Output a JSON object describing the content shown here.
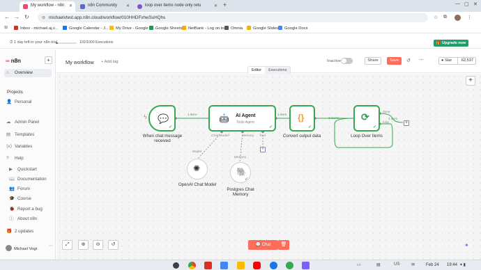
{
  "browser": {
    "tabs": [
      {
        "title": "My workflow - n8n",
        "active": true,
        "color": "#ea4b71"
      },
      {
        "title": "n8n Community",
        "active": false,
        "color": "#5c6bc0"
      },
      {
        "title": "loop over items node only retu",
        "active": false,
        "color": "#7e57c2"
      }
    ],
    "url": "michaelvtest.app.n8n.cloud/workflow/010HHDFxhwSuHQhs",
    "bookmarks": [
      {
        "label": "Inbox - michael.aj.v...",
        "color": "#d93025"
      },
      {
        "label": "Google Calendar - J...",
        "color": "#1a73e8"
      },
      {
        "label": "My Drive - Google D...",
        "color": "#fbbc04"
      },
      {
        "label": "Google Sheets",
        "color": "#0f9d58"
      },
      {
        "label": "NetBank - Log on to...",
        "color": "#f9ab00"
      },
      {
        "label": "Omnia",
        "color": "#555555"
      },
      {
        "label": "Google Slides",
        "color": "#f4b400"
      },
      {
        "label": "Google Docs",
        "color": "#4285f4"
      }
    ]
  },
  "banner": {
    "trial_text": "1 day left in your n8n trial",
    "executions": "102/1000 Executions",
    "progress": 0.102,
    "upgrade_label": "Upgrade now"
  },
  "sidebar": {
    "logo": "n8n",
    "overview": "Overview",
    "projects_heading": "Projects",
    "personal": "Personal",
    "bottom_items": [
      "Admin Panel",
      "Templates",
      "Variables",
      "Help"
    ],
    "help_items": [
      "Quickstart",
      "Documentation",
      "Forum",
      "Course",
      "Report a bug",
      "About n8n"
    ],
    "updates": "2 updates",
    "user_name": "Michael Vogt"
  },
  "topbar": {
    "workflow_name": "My workflow",
    "add_tag": "+ Add tag",
    "inactive_label": "Inactive",
    "share_label": "Share",
    "save_label": "Save",
    "star_label": "Star",
    "star_count": "62,537"
  },
  "mode_tabs": {
    "editor": "Editor",
    "executions": "Executions"
  },
  "nodes": {
    "chat_trigger": {
      "label": "When chat message received"
    },
    "ai_agent": {
      "title": "AI Agent",
      "subtitle": "Tools Agent"
    },
    "code": {
      "label": "Convert output data"
    },
    "loop": {
      "label": "Loop Over Items"
    },
    "openai": {
      "label": "OpenAI Chat Model"
    },
    "postgres": {
      "label": "Postgres Chat Memory"
    }
  },
  "connections": {
    "c1": "1 item",
    "c2": "1 item",
    "c3": "3 items",
    "loop_done": "done",
    "loop_loop": "loop",
    "loop_out": "1 item"
  },
  "ports": {
    "chat_model": "Chat Model*",
    "memory": "Memory",
    "tool": "Tool",
    "model_tag": "Model",
    "memory_tag": "Memory"
  },
  "bottom": {
    "chat_label": "Chat"
  },
  "taskbar": {
    "date": "Feb 24",
    "time": "19:44",
    "locale": "US"
  }
}
